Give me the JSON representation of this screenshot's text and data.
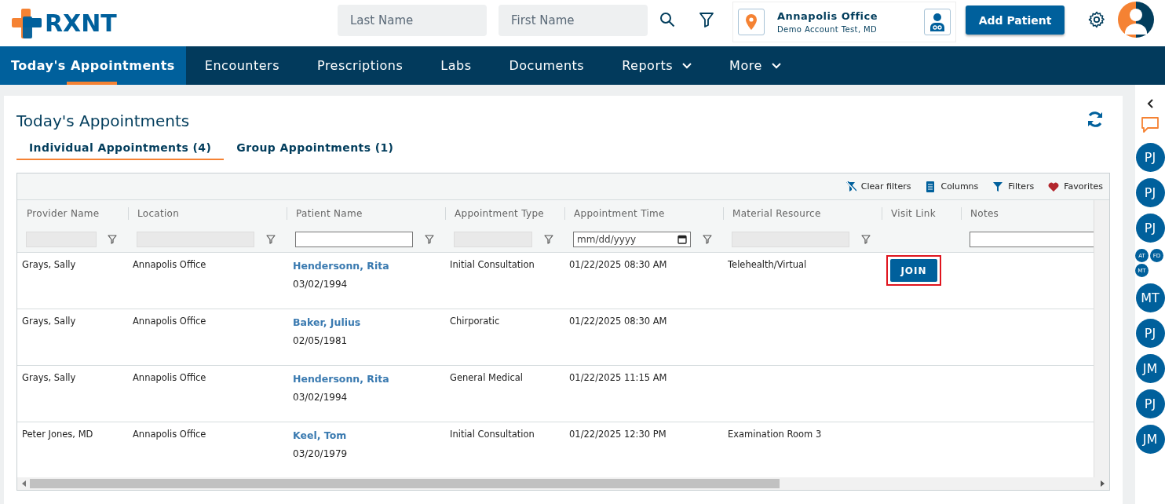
{
  "header": {
    "logo": "RXNT",
    "search_fields": [
      {
        "placeholder": "Last Name"
      },
      {
        "placeholder": "First Name"
      }
    ],
    "office": {
      "name": "Annapolis Office",
      "account": "Demo Account Test, MD"
    },
    "add_button": "Add Patient"
  },
  "nav": [
    {
      "label": "Today's Appointments",
      "selected": true,
      "dropdown": false
    },
    {
      "label": "Encounters",
      "selected": false,
      "dropdown": false
    },
    {
      "label": "Prescriptions",
      "selected": false,
      "dropdown": false
    },
    {
      "label": "Labs",
      "selected": false,
      "dropdown": false
    },
    {
      "label": "Documents",
      "selected": false,
      "dropdown": false
    },
    {
      "label": "Reports",
      "selected": false,
      "dropdown": true
    },
    {
      "label": "More",
      "selected": false,
      "dropdown": true
    }
  ],
  "page": {
    "title": "Today's Appointments",
    "tabs": [
      {
        "label": "Individual Appointments (4)",
        "selected": true
      },
      {
        "label": "Group Appointments (1)",
        "selected": false
      }
    ],
    "toolbar": [
      {
        "kind": "clear",
        "label": "Clear filters"
      },
      {
        "kind": "columns",
        "label": "Columns"
      },
      {
        "kind": "filters",
        "label": "Filters"
      },
      {
        "kind": "favorites",
        "label": "Favorites"
      }
    ],
    "table": {
      "columns": [
        {
          "label": "Provider Name",
          "kind": "locked"
        },
        {
          "label": "Location",
          "kind": "locked"
        },
        {
          "label": "Patient Name",
          "kind": "text"
        },
        {
          "label": "Appointment Type",
          "kind": "locked"
        },
        {
          "label": "Appointment Time",
          "kind": "date",
          "placeholder": "mm/dd/yyyy"
        },
        {
          "label": "Material Resource",
          "kind": "locked"
        },
        {
          "label": "Visit Link",
          "kind": "none"
        },
        {
          "label": "Notes",
          "kind": "plain"
        }
      ],
      "rows": [
        {
          "provider": "Grays, Sally",
          "location": "Annapolis Office",
          "patient": "Hendersonn, Rita",
          "dob": "03/02/1994",
          "type": "Initial Consultation",
          "time": "01/22/2025 08:30 AM",
          "resource": "Telehealth/Virtual",
          "visit_link": {
            "label": "JOIN",
            "highlighted": true
          }
        },
        {
          "provider": "Grays, Sally",
          "location": "Annapolis Office",
          "patient": "Baker, Julius",
          "dob": "02/05/1981",
          "type": "Chirporatic",
          "time": "01/22/2025 08:30 AM"
        },
        {
          "provider": "Grays, Sally",
          "location": "Annapolis Office",
          "patient": "Hendersonn, Rita",
          "dob": "03/02/1994",
          "type": "General Medical",
          "time": "01/22/2025 11:15 AM"
        },
        {
          "provider": "Peter Jones, MD",
          "location": "Annapolis Office",
          "patient": "Keel, Tom",
          "dob": "03/20/1979",
          "type": "Initial Consultation",
          "time": "01/22/2025 12:30 PM",
          "resource": "Examination Room 3"
        }
      ]
    }
  },
  "sidebar": {
    "chats": [
      {
        "kind": "single",
        "initials": [
          "PJ"
        ]
      },
      {
        "kind": "single",
        "initials": [
          "PJ"
        ]
      },
      {
        "kind": "single",
        "initials": [
          "PJ"
        ]
      },
      {
        "kind": "group",
        "initials": [
          "AT",
          "FD",
          "MT"
        ]
      },
      {
        "kind": "single",
        "initials": [
          "MT"
        ]
      },
      {
        "kind": "single",
        "initials": [
          "PJ"
        ]
      },
      {
        "kind": "single",
        "initials": [
          "JM"
        ]
      },
      {
        "kind": "single",
        "initials": [
          "PJ"
        ]
      },
      {
        "kind": "single",
        "initials": [
          "JM"
        ]
      }
    ]
  }
}
